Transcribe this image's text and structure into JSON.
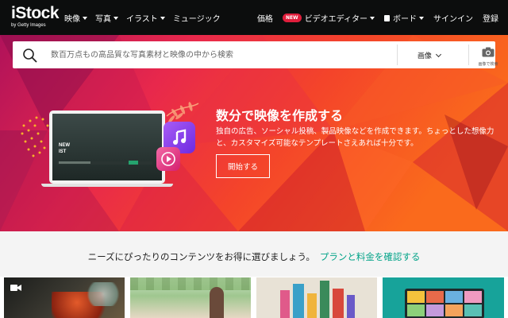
{
  "logo": {
    "main": "iStock",
    "sub": "by Getty Images"
  },
  "nav": {
    "items": [
      {
        "label": "映像"
      },
      {
        "label": "写真"
      },
      {
        "label": "イラスト"
      },
      {
        "label": "ミュージック"
      }
    ]
  },
  "right_nav": {
    "pricing": "価格",
    "new_badge": "NEW",
    "video_editor": "ビデオエディター",
    "boards": "ボード",
    "signin": "サインイン",
    "register": "登録"
  },
  "search": {
    "placeholder": "数百万点もの高品質な写真素材と映像の中から検索",
    "media_type": "画像",
    "camera_label": "画像で検索"
  },
  "hero": {
    "title": "数分で映像を作成する",
    "description": "独自の広告、ソーシャル投稿、製品映像などを作成できます。ちょっとした想像力と、カスタマイズ可能なテンプレートさえあれば十分です。",
    "cta": "開始する",
    "laptop_screen_text": [
      "NEW",
      "IST"
    ]
  },
  "promo": {
    "text": "ニーズにぴったりのコンテンツをお得に選びましょう。",
    "link": "プランと料金を確認する"
  },
  "colors": {
    "topbar": "#0c0d0d",
    "accent_green": "#02a388",
    "badge_red": "#e01e3c",
    "music_purple": "#8a3cf0",
    "play_pink": "#e83c8c"
  }
}
